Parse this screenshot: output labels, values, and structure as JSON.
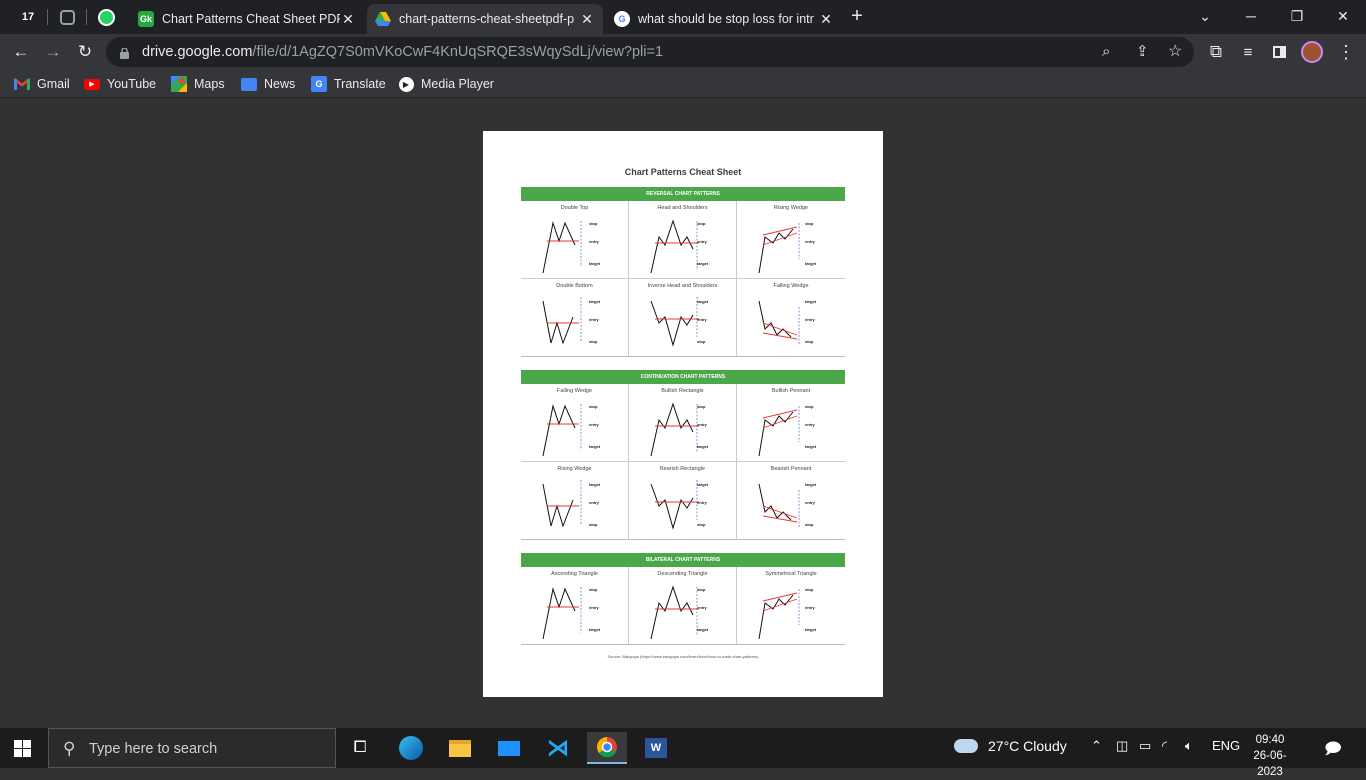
{
  "tabs": [
    {
      "title": "Chart Patterns Cheat Sheet PDF F",
      "icon": "gk-icon",
      "icon_text": "Gk",
      "active": false
    },
    {
      "title": "chart-patterns-cheat-sheetpdf-p",
      "icon": "google-drive-icon",
      "active": true
    },
    {
      "title": "what should be stop loss for intr",
      "icon": "google-icon",
      "active": false
    }
  ],
  "pinned": [
    {
      "name": "tradingview-pinned-tab",
      "text": "17"
    },
    {
      "name": "chatgpt-pinned-tab"
    },
    {
      "name": "whatsapp-pinned-tab"
    }
  ],
  "address": {
    "host": "drive.google.com",
    "path": "/file/d/1AgZQ7S0mVKoCwF4KnUqSRQE3sWqySdLj/view?pli=1"
  },
  "bookmarks": [
    {
      "label": "Gmail",
      "icon": "gmail-icon"
    },
    {
      "label": "YouTube",
      "icon": "youtube-icon"
    },
    {
      "label": "Maps",
      "icon": "maps-icon"
    },
    {
      "label": "News",
      "icon": "news-icon"
    },
    {
      "label": "Translate",
      "icon": "translate-icon"
    },
    {
      "label": "Media Player",
      "icon": "media-player-icon"
    }
  ],
  "document": {
    "title": "Chart Patterns Cheat Sheet",
    "sections": [
      {
        "title": "REVERSAL CHART PATTERNS",
        "patterns": [
          "Double Top",
          "Head and Shoulders",
          "Rising Wedge",
          "Double Bottom",
          "Inverse Head and Shoulders",
          "Falling Wedge"
        ]
      },
      {
        "title": "CONTINUATION CHART PATTERNS",
        "patterns": [
          "Falling Wedge",
          "Bullish Rectangle",
          "Bullish Pennant",
          "Rising Wedge",
          "Bearish Rectangle",
          "Bearish Pennant"
        ]
      },
      {
        "title": "BILATERAL CHART PATTERNS",
        "patterns": [
          "Ascending Triangle",
          "Descending Triangle",
          "Symmetrical Triangle"
        ]
      }
    ],
    "labels": {
      "stop": "stop",
      "entry": "entry",
      "target": "target",
      "neckline": "neckline"
    },
    "source": "Source: Babypips (https://www.babypips.com/learn/forex/how-to-trade-chart-patterns)"
  },
  "taskbar": {
    "search_placeholder": "Type here to search",
    "weather": "27°C  Cloudy",
    "language": "ENG",
    "time": "09:40",
    "date": "26-06-2023"
  }
}
